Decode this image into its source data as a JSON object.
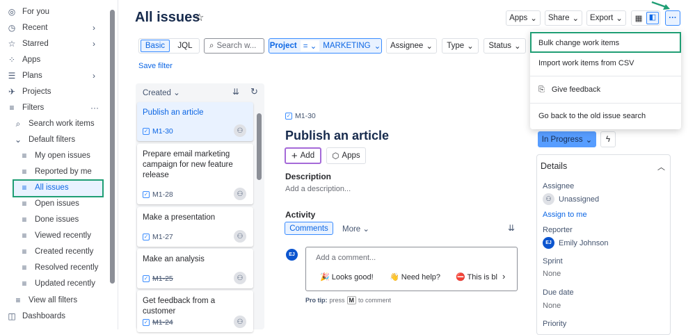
{
  "sidebar": {
    "items": [
      {
        "label": "For you",
        "icon": "user-circle-icon"
      },
      {
        "label": "Recent",
        "icon": "clock-icon"
      },
      {
        "label": "Starred",
        "icon": "star-icon"
      },
      {
        "label": "Apps",
        "icon": "apps-icon"
      },
      {
        "label": "Plans",
        "icon": "plans-icon"
      },
      {
        "label": "Projects",
        "icon": "rocket-icon"
      },
      {
        "label": "Filters",
        "icon": "filter-icon"
      }
    ],
    "search_work_items": "Search work items",
    "default_filters": "Default filters",
    "filters": [
      "My open issues",
      "Reported by me",
      "All issues",
      "Open issues",
      "Done issues",
      "Viewed recently",
      "Created recently",
      "Resolved recently",
      "Updated recently"
    ],
    "view_all_filters": "View all filters",
    "dashboards": "Dashboards"
  },
  "header": {
    "title": "All issues",
    "apps": "Apps",
    "share": "Share",
    "export": "Export",
    "more": "···"
  },
  "filter_bar": {
    "basic": "Basic",
    "jql": "JQL",
    "search_placeholder": "Search w...",
    "project_label": "Project",
    "operator": "=",
    "project_value": "MARKETING",
    "assignee": "Assignee",
    "type": "Type",
    "status": "Status",
    "save_filter": "Save filter"
  },
  "list": {
    "sort_label": "Created",
    "items": [
      {
        "title": "Publish an article",
        "key": "M1-30",
        "done": false
      },
      {
        "title": "Prepare email marketing campaign for new feature release",
        "key": "M1-28",
        "done": false
      },
      {
        "title": "Make a presentation",
        "key": "M1-27",
        "done": false
      },
      {
        "title": "Make an analysis",
        "key": "M1-25",
        "done": true
      },
      {
        "title": "Get feedback from a customer",
        "key": "M1-24",
        "done": true
      }
    ]
  },
  "detail": {
    "key": "M1-30",
    "title": "Publish an article",
    "add": "Add",
    "apps": "Apps",
    "description_heading": "Description",
    "description_placeholder": "Add a description...",
    "activity_heading": "Activity",
    "comments_tab": "Comments",
    "more_tab": "More",
    "avatar_initials": "EJ",
    "comment_placeholder": "Add a comment...",
    "quick_replies": [
      "🎉 Looks good!",
      "👋 Need help?",
      "⛔ This is bl"
    ],
    "pro_tip_label": "Pro tip:",
    "pro_tip_pre": "press",
    "pro_tip_key": "M",
    "pro_tip_post": "to comment"
  },
  "menu": {
    "items": [
      "Bulk change work items",
      "Import work items from CSV",
      "Give feedback",
      "Go back to the old issue search"
    ]
  },
  "side": {
    "status": "In Progress",
    "details": "Details",
    "assignee_label": "Assignee",
    "assignee_value": "Unassigned",
    "assign_to_me": "Assign to me",
    "reporter_label": "Reporter",
    "reporter_value": "Emily Johnson",
    "reporter_initials": "EJ",
    "sprint_label": "Sprint",
    "sprint_value": "None",
    "due_label": "Due date",
    "due_value": "None",
    "priority_label": "Priority"
  },
  "colors": {
    "accent": "#0c66e4",
    "highlight": "#1f9e74",
    "selected_bg": "#e9f2ff"
  }
}
